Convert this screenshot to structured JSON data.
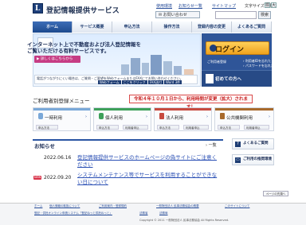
{
  "header": {
    "logo_letter": "L",
    "site_title": "登記情報提供サービス",
    "links": [
      "使用環境",
      "お知らせ一覧",
      "サイトマップ"
    ],
    "font_size_label": "文字サイズ変更",
    "font_sizes": [
      "標",
      "大"
    ],
    "contact_label": "お問い合わせ",
    "search_placeholder": "",
    "search_button": "検索"
  },
  "nav": {
    "items": [
      "ホーム",
      "サービス概要",
      "申込方法",
      "操作方法",
      "登録内容の変更",
      "よくあるご質問"
    ]
  },
  "hero": {
    "line1": "インターネット上で不動産および法人登記情報を",
    "line2": "ご覧いただける有料サービスです。",
    "button_label": "▶ 詳しくはこちらから",
    "note": "電話がつながりにくい場合は、ご質問・ご要望をWebフォームまたはFAXにてお問い合わせください。",
    "tags": [
      "Webフォーム",
      "ここをクリック",
      "FAX送付",
      "Word 3件"
    ]
  },
  "login": {
    "button_label": "ログイン",
    "user_reg_label": "ご利用者登録",
    "link1": "› 利用者IDを忘れた",
    "link2": "› パスワードを忘れた",
    "first_time_label": "初めての方へ"
  },
  "menu": {
    "heading": "ご利用者別登録メニュー",
    "notice": "令和４年１０月１日から、利用時間が変更（拡大）されます！",
    "cards": [
      {
        "title": "一時利用",
        "btn1": "申込方法",
        "btn2": "",
        "color": "#7aa8d8"
      },
      {
        "title": "個人利用",
        "btn1": "申込方法",
        "btn2": "利用者申込",
        "color": "#3ea05a"
      },
      {
        "title": "法人利用",
        "btn1": "申込方法",
        "btn2": "利用者申込",
        "color": "#c74a3f"
      },
      {
        "title": "公共機関利用",
        "btn1": "申込方法",
        "btn2": "利用者申込",
        "color": "#a86a2c"
      }
    ]
  },
  "news": {
    "heading": "お知らせ",
    "all_label": "一覧",
    "items": [
      {
        "new": "",
        "date": "2022.06.16",
        "text": "登記情報提供サービスのホームページの偽サイトにご注意ください"
      },
      {
        "new": "NEW",
        "date": "2022.09.20",
        "text": "システムメンテナンス等でサービスを利用することができない日について"
      }
    ],
    "more_label": "ページの先頭へ"
  },
  "side": {
    "faq_label": "よくあるご質問",
    "browser_label": "ご利用の推奨環境"
  },
  "footer": {
    "links": [
      "ホーム",
      "個人情報の取扱について",
      "ご利用案内・登録規約",
      "一般財団法人 民事法務協会の概要",
      "このサイトについて"
    ],
    "links2": [
      "登記・供託オンライン申請システム「登記ねっと供託ねっと」",
      "法務省",
      "法務局"
    ],
    "copyright": "Copyright © 2011 一般財団法人 民事法務協会 All Rights Reserved."
  }
}
